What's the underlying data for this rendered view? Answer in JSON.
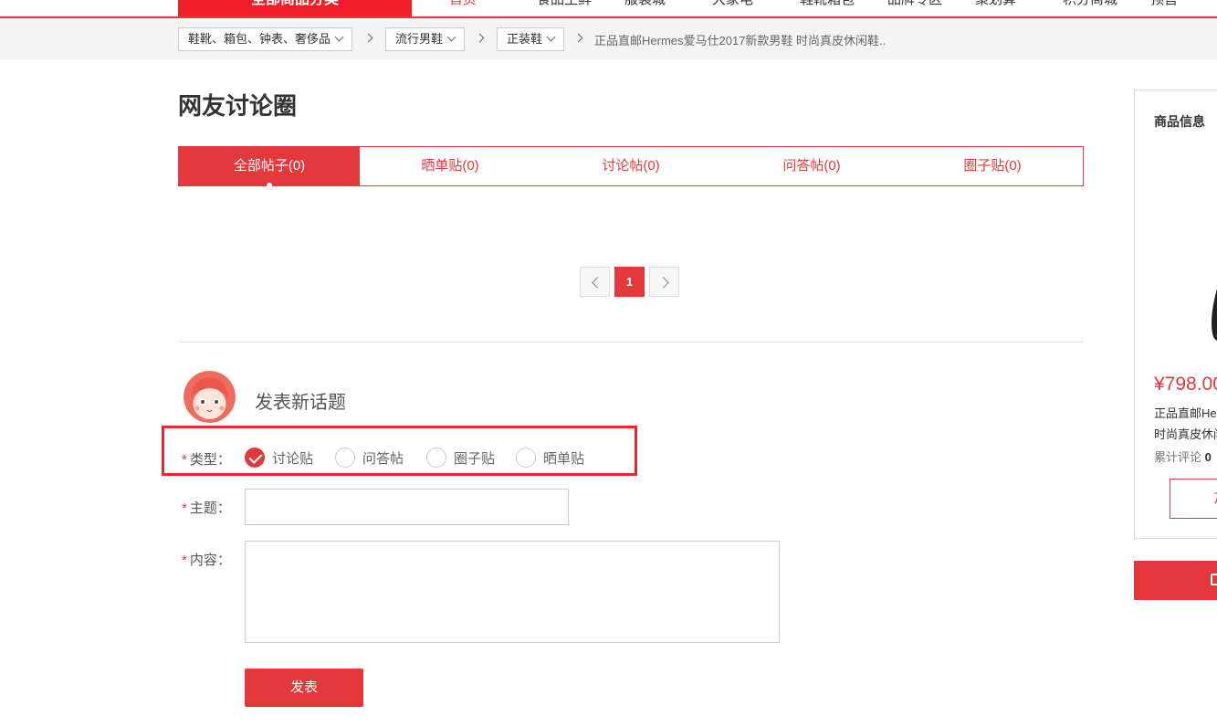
{
  "top_nav": {
    "all_categories": "全部商品分类",
    "links": [
      "首页",
      "食品生鲜",
      "服装城",
      "大家电",
      "鞋靴箱包",
      "品牌专区",
      "聚划算",
      "积分商城",
      "预售"
    ],
    "active_index": 0
  },
  "breadcrumb": {
    "levels": [
      "鞋靴、箱包、钟表、奢侈品",
      "流行男鞋",
      "正装鞋"
    ],
    "product": "正品直邮Hermes爱马仕2017新款男鞋 时尚真皮休闲鞋.."
  },
  "page_title": "网友讨论圈",
  "tabs": [
    "全部帖子(0)",
    "晒单贴(0)",
    "讨论帖(0)",
    "问答帖(0)",
    "圈子贴(0)"
  ],
  "active_tab": 0,
  "pagination": {
    "current": "1"
  },
  "new_topic": {
    "heading": "发表新话题",
    "type_label": "类型：",
    "types": [
      "讨论贴",
      "问答帖",
      "圈子贴",
      "晒单贴"
    ],
    "selected_type": 0,
    "subject_label": "主题：",
    "content_label": "内容：",
    "required_mark": "*",
    "submit_label": "发表"
  },
  "side_card": {
    "title": "商品信息",
    "price": "¥798.00",
    "name_line1": "正品直邮Hermes爱马仕",
    "name_line2": "时尚真皮休闲鞋",
    "comments_label": "累计评论",
    "comments_count": "0",
    "button_label": "加入购物车"
  },
  "colors": {
    "accent": "#e4393c",
    "highlight_box": "#e62828"
  }
}
